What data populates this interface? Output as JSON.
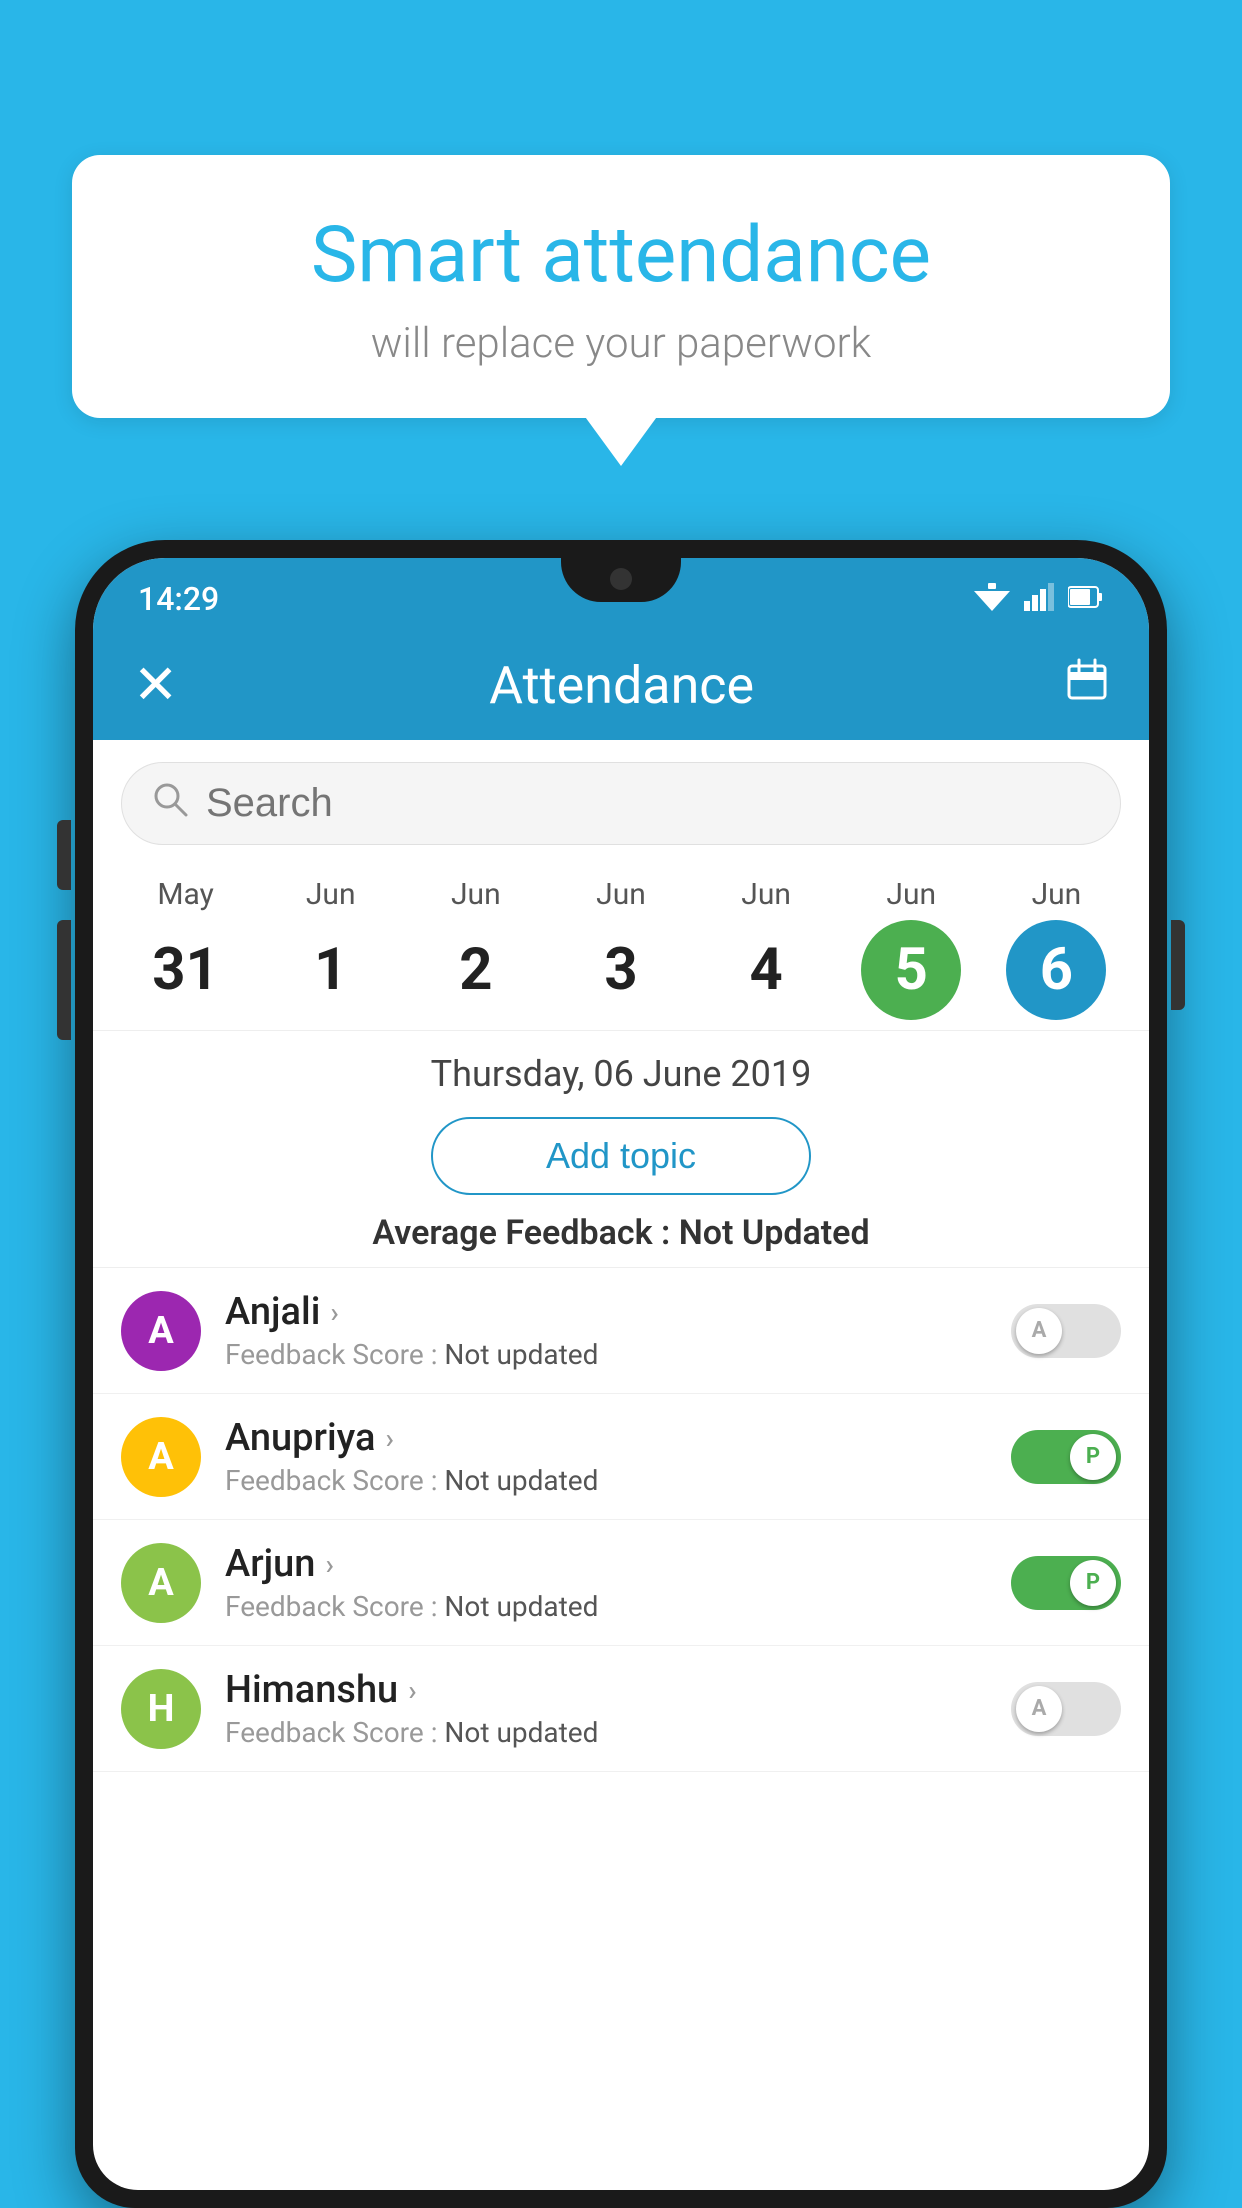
{
  "bubble": {
    "title": "Smart attendance",
    "subtitle": "will replace your paperwork"
  },
  "status_bar": {
    "time": "14:29",
    "wifi": "▲",
    "signal": "◀",
    "battery": "▮"
  },
  "app_bar": {
    "title": "Attendance",
    "close_label": "✕",
    "calendar_label": "📅"
  },
  "search": {
    "placeholder": "Search"
  },
  "dates": [
    {
      "month": "May",
      "day": "31",
      "style": "normal"
    },
    {
      "month": "Jun",
      "day": "1",
      "style": "normal"
    },
    {
      "month": "Jun",
      "day": "2",
      "style": "normal"
    },
    {
      "month": "Jun",
      "day": "3",
      "style": "normal"
    },
    {
      "month": "Jun",
      "day": "4",
      "style": "normal"
    },
    {
      "month": "Jun",
      "day": "5",
      "style": "today"
    },
    {
      "month": "Jun",
      "day": "6",
      "style": "selected"
    }
  ],
  "selected_date": "Thursday, 06 June 2019",
  "add_topic_label": "Add topic",
  "avg_feedback": {
    "label": "Average Feedback : ",
    "value": "Not Updated"
  },
  "students": [
    {
      "name": "Anjali",
      "feedback_label": "Feedback Score : ",
      "feedback_value": "Not updated",
      "avatar_letter": "A",
      "avatar_color": "#9c27b0",
      "toggle": "off",
      "toggle_letter": "A"
    },
    {
      "name": "Anupriya",
      "feedback_label": "Feedback Score : ",
      "feedback_value": "Not updated",
      "avatar_letter": "A",
      "avatar_color": "#FFC107",
      "toggle": "on",
      "toggle_letter": "P"
    },
    {
      "name": "Arjun",
      "feedback_label": "Feedback Score : ",
      "feedback_value": "Not updated",
      "avatar_letter": "A",
      "avatar_color": "#8BC34A",
      "toggle": "on",
      "toggle_letter": "P"
    },
    {
      "name": "Himanshu",
      "feedback_label": "Feedback Score : ",
      "feedback_value": "Not updated",
      "avatar_letter": "H",
      "avatar_color": "#8BC34A",
      "toggle": "off",
      "toggle_letter": "A"
    }
  ]
}
